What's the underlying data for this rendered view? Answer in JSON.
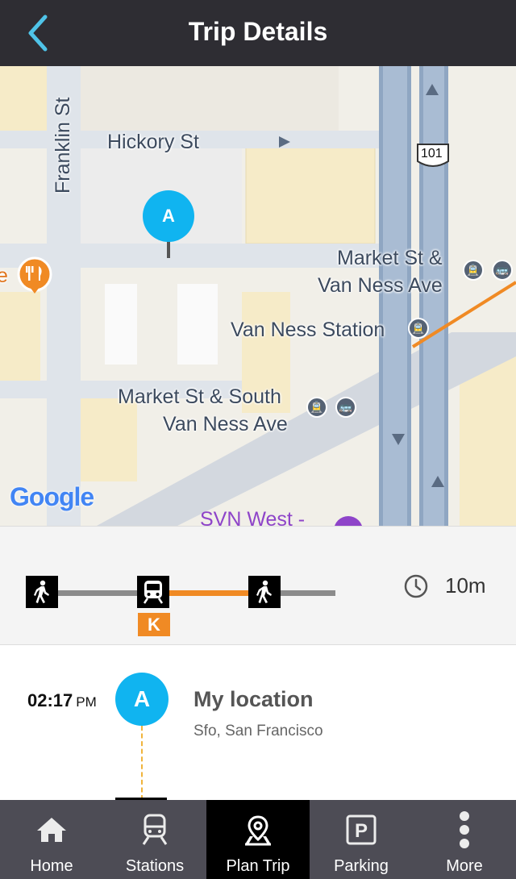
{
  "header": {
    "title": "Trip Details",
    "back_icon": "chevron-left-icon"
  },
  "colors": {
    "header_bg": "#2e2d33",
    "accent_cyan": "#10b4f0",
    "train_orange": "#f08a24",
    "walk_gray": "#8b8b8b",
    "tabbar_bg": "#4d4c55",
    "tab_active_bg": "#000000"
  },
  "map": {
    "streets": {
      "franklin": "Franklin St",
      "hickory": "Hickory St"
    },
    "stations": {
      "market_van_ness_line1": "Market St &",
      "market_van_ness_line2": "Van Ness Ave",
      "van_ness_station": "Van Ness Station",
      "market_south_line1": "Market St & South",
      "market_south_line2": "Van Ness Ave"
    },
    "highway_shield": "101",
    "marker_label": "A",
    "partial_label": "SVN West -",
    "partial_left": "e",
    "logo": "Google"
  },
  "summary": {
    "legs": [
      "walk-icon",
      "train-icon",
      "walk-icon"
    ],
    "route_badge": "K",
    "duration": "10m",
    "clock_icon": "clock-icon"
  },
  "itinerary": {
    "stops": [
      {
        "time": "02:17",
        "ampm": "PM",
        "marker": "A",
        "name": "My location",
        "sub": "Sfo, San Francisco"
      }
    ]
  },
  "tabs": [
    {
      "label": "Home",
      "icon": "home-icon",
      "active": false
    },
    {
      "label": "Stations",
      "icon": "train-icon",
      "active": false
    },
    {
      "label": "Plan Trip",
      "icon": "map-pin-icon",
      "active": true
    },
    {
      "label": "Parking",
      "icon": "parking-icon",
      "active": false
    },
    {
      "label": "More",
      "icon": "more-vertical-icon",
      "active": false
    }
  ]
}
